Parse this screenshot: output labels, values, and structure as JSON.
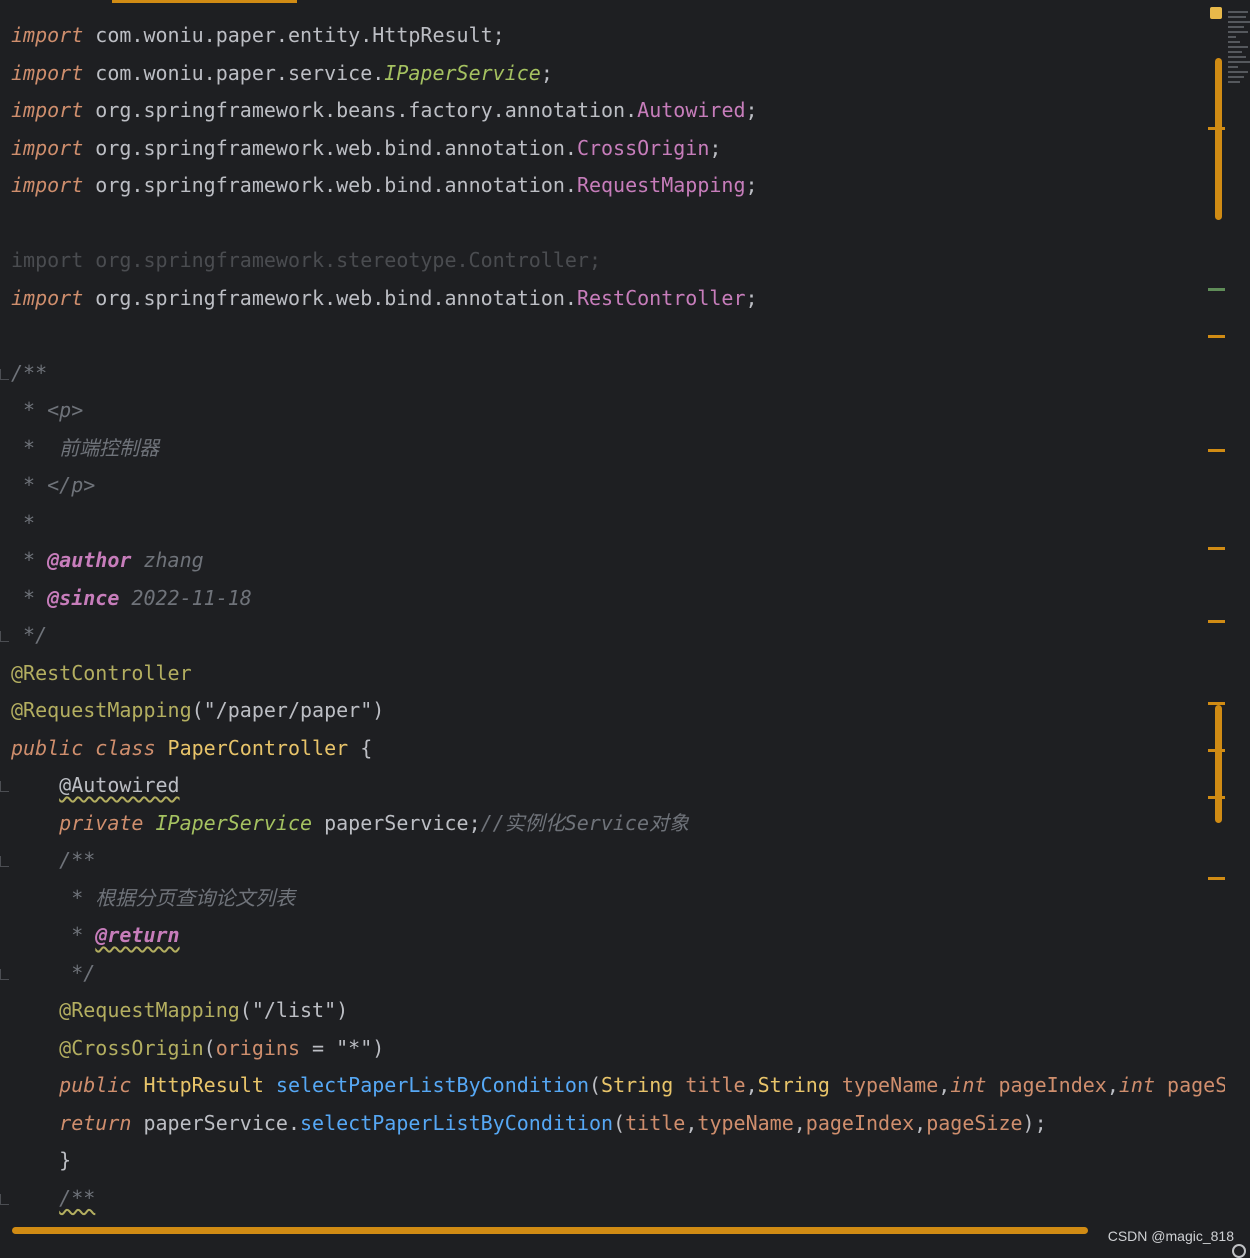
{
  "editor": {
    "lines": [
      {
        "id": "l1",
        "tokens": [
          [
            "import ",
            "kw"
          ],
          [
            "com.woniu.paper.entity.HttpResult;",
            "pkg"
          ]
        ]
      },
      {
        "id": "l2",
        "tokens": [
          [
            "import ",
            "kw"
          ],
          [
            "com.woniu.paper.service.",
            "pkg"
          ],
          [
            "IPaperService",
            "iface"
          ],
          [
            ";",
            "pkg"
          ]
        ]
      },
      {
        "id": "l3",
        "tokens": [
          [
            "import ",
            "kw"
          ],
          [
            "org.springframework.beans.factory.annotation.",
            "pkg"
          ],
          [
            "Autowired",
            "cls"
          ],
          [
            ";",
            "pkg"
          ]
        ]
      },
      {
        "id": "l4",
        "tokens": [
          [
            "import ",
            "kw"
          ],
          [
            "org.springframework.web.bind.annotation.",
            "pkg"
          ],
          [
            "CrossOrigin",
            "cls"
          ],
          [
            ";",
            "pkg"
          ]
        ]
      },
      {
        "id": "l5",
        "tokens": [
          [
            "import ",
            "kw"
          ],
          [
            "org.springframework.web.bind.annotation.",
            "pkg"
          ],
          [
            "RequestMapping",
            "cls"
          ],
          [
            ";",
            "pkg"
          ]
        ]
      },
      {
        "id": "l6",
        "tokens": []
      },
      {
        "id": "l7",
        "tokens": [
          [
            "import org.springframework.stereotype.Controller;",
            "dim"
          ]
        ]
      },
      {
        "id": "l8",
        "tokens": [
          [
            "import ",
            "kw"
          ],
          [
            "org.springframework.web.bind.annotation.",
            "pkg"
          ],
          [
            "RestController",
            "cls"
          ],
          [
            ";",
            "pkg"
          ]
        ]
      },
      {
        "id": "l9",
        "tokens": []
      },
      {
        "id": "l10",
        "tokens": [
          [
            "/**",
            "cmt"
          ]
        ]
      },
      {
        "id": "l11",
        "tokens": [
          [
            " * <p>",
            "cmt"
          ]
        ]
      },
      {
        "id": "l12",
        "tokens": [
          [
            " *  前端控制器",
            "cmt"
          ]
        ]
      },
      {
        "id": "l13",
        "tokens": [
          [
            " * </p>",
            "cmt"
          ]
        ]
      },
      {
        "id": "l14",
        "tokens": [
          [
            " *",
            "cmt"
          ]
        ]
      },
      {
        "id": "l15",
        "tokens": [
          [
            " * ",
            "cmt"
          ],
          [
            "@author",
            "doctag"
          ],
          [
            " zhang",
            "cmt"
          ]
        ]
      },
      {
        "id": "l16",
        "tokens": [
          [
            " * ",
            "cmt"
          ],
          [
            "@since",
            "doctag"
          ],
          [
            " 2022-11-18",
            "cmt"
          ]
        ]
      },
      {
        "id": "l17",
        "tokens": [
          [
            " */",
            "cmt"
          ]
        ]
      },
      {
        "id": "l18",
        "tokens": [
          [
            "@RestController",
            "ann"
          ]
        ]
      },
      {
        "id": "l19",
        "tokens": [
          [
            "@RequestMapping",
            "ann"
          ],
          [
            "(\"/paper/paper\")",
            "strw"
          ]
        ]
      },
      {
        "id": "l20",
        "tokens": [
          [
            "public ",
            "kw"
          ],
          [
            "class ",
            "kw"
          ],
          [
            "PaperController ",
            "typ"
          ],
          [
            "{",
            "pkg"
          ]
        ]
      },
      {
        "id": "l21",
        "tokens": [
          [
            "    ",
            "pkg"
          ],
          [
            "@Autowired",
            "squig"
          ]
        ]
      },
      {
        "id": "l22",
        "tokens": [
          [
            "    ",
            "pkg"
          ],
          [
            "private ",
            "kw"
          ],
          [
            "IPaperService ",
            "iface"
          ],
          [
            "paperService;",
            "pkg"
          ],
          [
            "//实例化Service对象",
            "cmt"
          ]
        ]
      },
      {
        "id": "l23",
        "tokens": [
          [
            "    /**",
            "cmt"
          ]
        ]
      },
      {
        "id": "l24",
        "tokens": [
          [
            "     * 根据分页查询论文列表",
            "cmt"
          ]
        ]
      },
      {
        "id": "l25",
        "tokens": [
          [
            "     * ",
            "cmt"
          ],
          [
            "@return",
            "doctag squig2"
          ]
        ]
      },
      {
        "id": "l26",
        "tokens": [
          [
            "     */",
            "cmt"
          ]
        ]
      },
      {
        "id": "l27",
        "tokens": [
          [
            "    ",
            "pkg"
          ],
          [
            "@RequestMapping",
            "ann"
          ],
          [
            "(\"/list\")",
            "strw"
          ]
        ]
      },
      {
        "id": "l28",
        "tokens": [
          [
            "    ",
            "pkg"
          ],
          [
            "@CrossOrigin",
            "ann"
          ],
          [
            "(",
            "pkg"
          ],
          [
            "origins",
            "param"
          ],
          [
            " = \"*\")",
            "strw"
          ]
        ]
      },
      {
        "id": "l29",
        "tokens": [
          [
            "    ",
            "pkg"
          ],
          [
            "public ",
            "kw"
          ],
          [
            "HttpResult ",
            "typ"
          ],
          [
            "selectPaperListByCondition",
            "method"
          ],
          [
            "(",
            "pkg"
          ],
          [
            "String ",
            "typ"
          ],
          [
            "title",
            "param"
          ],
          [
            ",",
            "pkg"
          ],
          [
            "String ",
            "typ"
          ],
          [
            "typeName",
            "param"
          ],
          [
            ",",
            "pkg"
          ],
          [
            "int ",
            "kw"
          ],
          [
            "pageIndex",
            "param"
          ],
          [
            ",",
            "pkg"
          ],
          [
            "int ",
            "kw"
          ],
          [
            "pageS",
            "param"
          ]
        ]
      },
      {
        "id": "l30",
        "tokens": [
          [
            "    ",
            "pkg"
          ],
          [
            "return ",
            "kw"
          ],
          [
            "paperService.",
            "pkg"
          ],
          [
            "selectPaperListByCondition",
            "method"
          ],
          [
            "(",
            "pkg"
          ],
          [
            "title",
            "param"
          ],
          [
            ",",
            "pkg"
          ],
          [
            "typeName",
            "param"
          ],
          [
            ",",
            "pkg"
          ],
          [
            "pageIndex",
            "param"
          ],
          [
            ",",
            "pkg"
          ],
          [
            "pageSize",
            "param"
          ],
          [
            ");",
            "pkg"
          ]
        ]
      },
      {
        "id": "l31",
        "tokens": [
          [
            "    }",
            "pkg"
          ]
        ]
      },
      {
        "id": "l32",
        "tokens": [
          [
            "    ",
            "pkg"
          ],
          [
            "/**",
            "cmt squig"
          ]
        ]
      }
    ]
  },
  "watermark": "CSDN @magic_818",
  "colors": {
    "accent": "#d08b14",
    "background": "#1e1f22"
  }
}
